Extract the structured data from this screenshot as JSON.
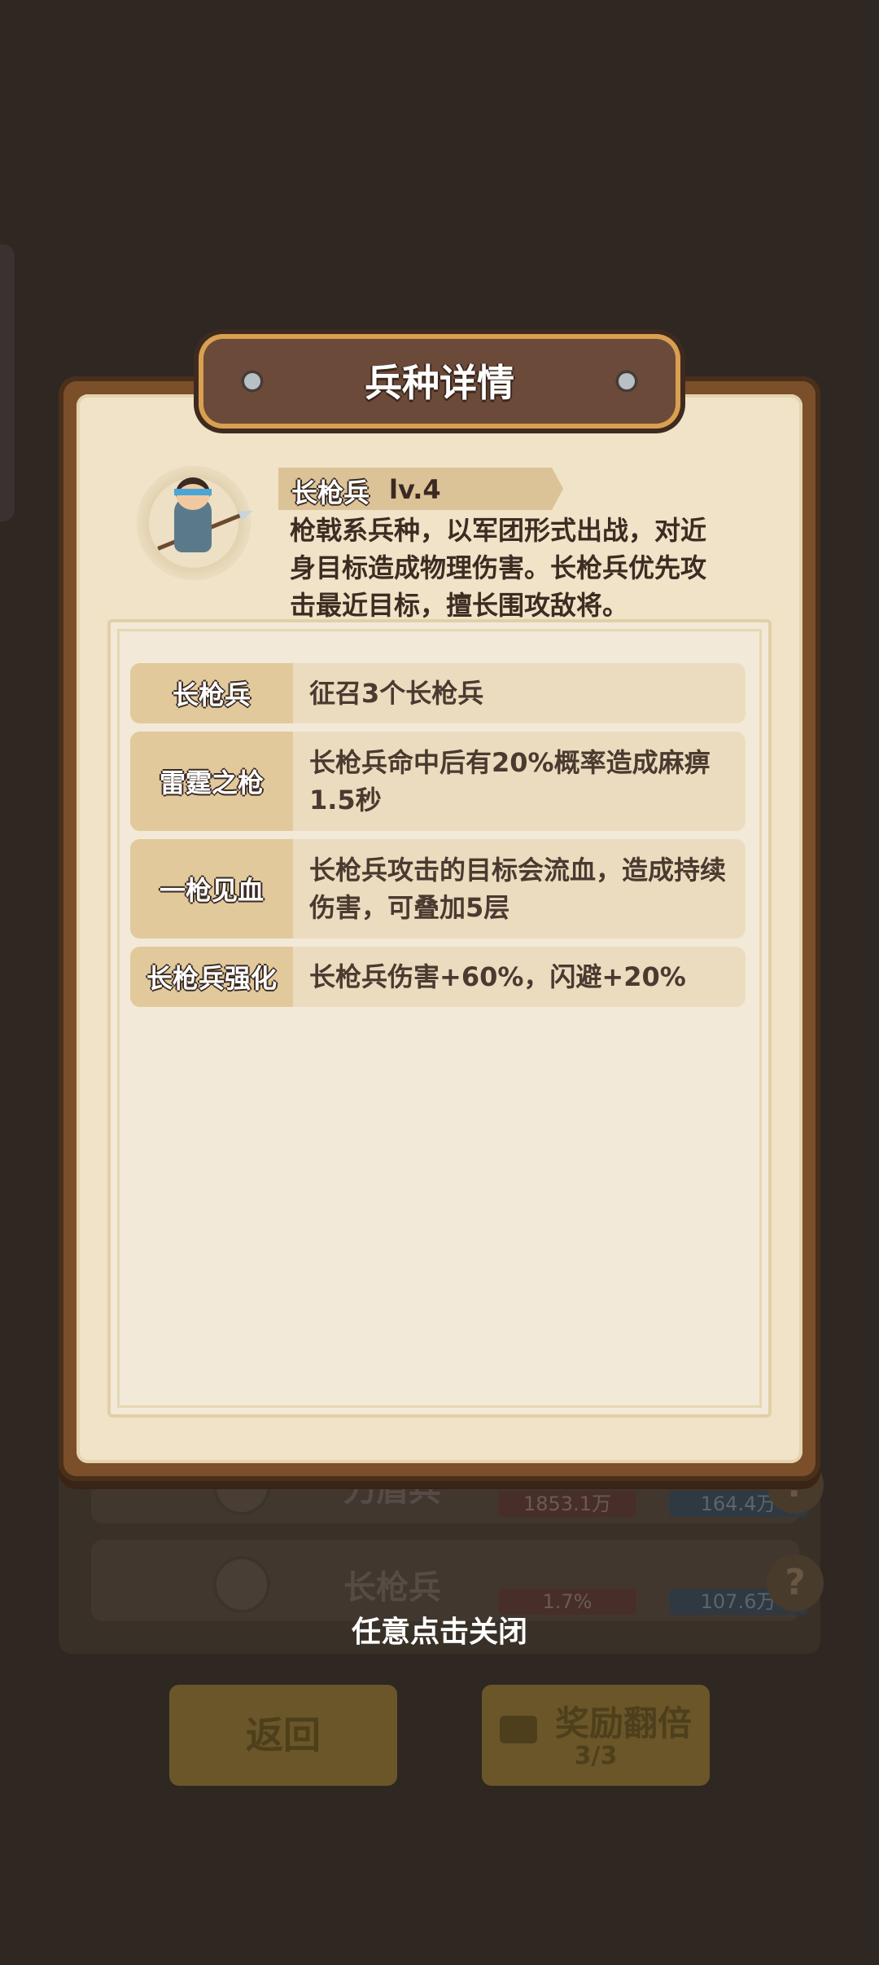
{
  "modal": {
    "title": "兵种详情",
    "unit": {
      "name": "长枪兵",
      "level": "lv.4",
      "description": "枪戟系兵种，以军团形式出战，对近身目标造成物理伤害。长枪兵优先攻击最近目标，擅长围攻敌将。"
    },
    "skills": [
      {
        "name": "长枪兵",
        "desc": "征召3个长枪兵"
      },
      {
        "name": "雷霆之枪",
        "desc": "长枪兵命中后有20%概率造成麻痹1.5秒"
      },
      {
        "name": "一枪见血",
        "desc": "长枪兵攻击的目标会流血，造成持续伤害，可叠加5层"
      },
      {
        "name": "长枪兵强化",
        "desc": "长枪兵伤害+60%，闪避+20%"
      }
    ],
    "close_hint": "任意点击关闭"
  },
  "background": {
    "rows": [
      {
        "name": "刀盾兵",
        "stat_a": "1853.1万",
        "stat_b": "164.4万",
        "help": "?"
      },
      {
        "name": "长枪兵",
        "stat_a": "1.7%",
        "stat_b": "107.6万",
        "help": "?"
      }
    ],
    "buttons": {
      "back": "返回",
      "double": "奖励翻倍",
      "double_count": "3/3"
    }
  }
}
